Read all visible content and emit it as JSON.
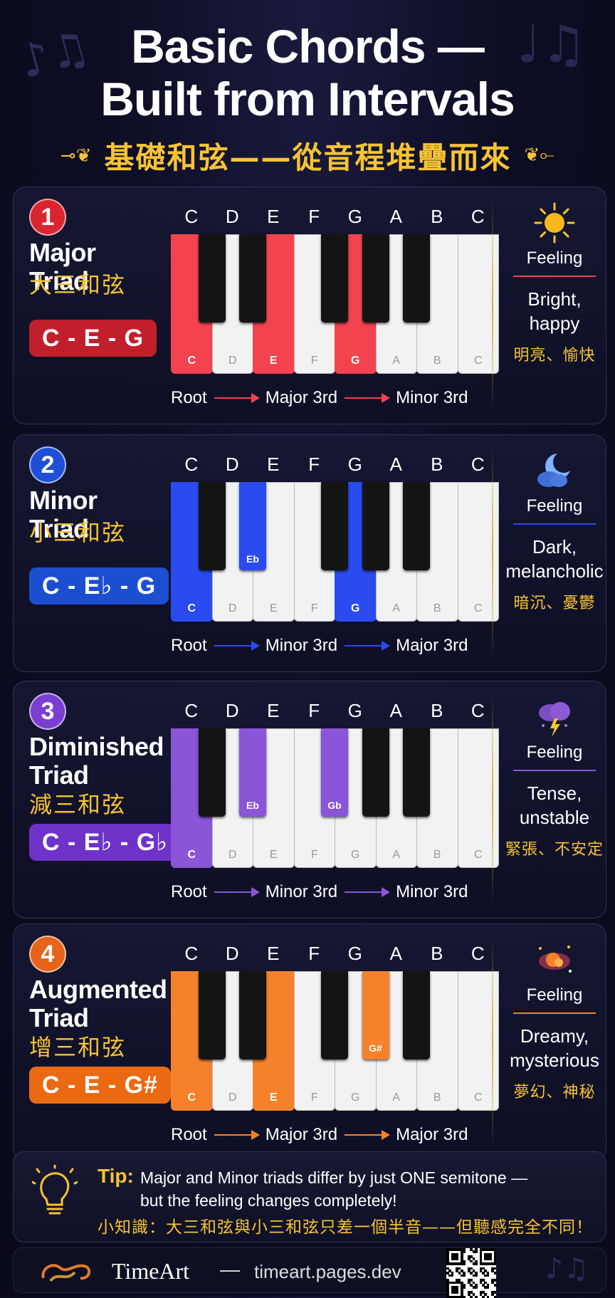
{
  "title_line1": "Basic Chords —",
  "title_line2": "Built from Intervals",
  "subtitle": "基礎和弦——從音程堆疊而來",
  "note_names": [
    "C",
    "D",
    "E",
    "F",
    "G",
    "A",
    "B",
    "C"
  ],
  "feeling_label": "Feeling",
  "chords": [
    {
      "number": "1",
      "name": "Major Triad",
      "zh": "大三和弦",
      "formula": "C - E - G",
      "color": "#f2434f",
      "badge_color": "#d9252f",
      "formula_bg": "#c21f2c",
      "intervals": [
        "Root",
        "Major 3rd",
        "Minor 3rd"
      ],
      "feeling_en": "Bright, happy",
      "feeling_zh": "明亮、愉快",
      "icon": "sun-icon",
      "highlight_white": [
        0,
        2,
        4
      ],
      "highlight_black": []
    },
    {
      "number": "2",
      "name": "Minor Triad",
      "zh": "小三和弦",
      "formula": "C - E♭ - G",
      "color": "#2a4bf0",
      "badge_color": "#1f4fd6",
      "formula_bg": "#1b4fcf",
      "intervals": [
        "Root",
        "Minor 3rd",
        "Major 3rd"
      ],
      "feeling_en": "Dark, melancholic",
      "feeling_zh": "暗沉、憂鬱",
      "icon": "moon-cloud-icon",
      "highlight_white": [
        0,
        4
      ],
      "highlight_black": [
        1
      ],
      "black_labels": {
        "1": "Eb"
      }
    },
    {
      "number": "3",
      "name": "Diminished Triad",
      "zh": "減三和弦",
      "formula": "C - E♭ - G♭",
      "color": "#8a55d6",
      "badge_color": "#7a3fd0",
      "formula_bg": "#6f32c8",
      "intervals": [
        "Root",
        "Minor 3rd",
        "Minor 3rd"
      ],
      "feeling_en": "Tense, unstable",
      "feeling_zh": "緊張、不安定",
      "icon": "storm-cloud-icon",
      "highlight_white": [
        0
      ],
      "highlight_black": [
        1,
        2
      ],
      "black_labels": {
        "1": "Eb",
        "2": "Gb"
      }
    },
    {
      "number": "4",
      "name": "Augmented Triad",
      "zh": "增三和弦",
      "formula": "C - E - G#",
      "color": "#f5822b",
      "badge_color": "#e5641a",
      "formula_bg": "#ea6a14",
      "intervals": [
        "Root",
        "Major 3rd",
        "Major 3rd"
      ],
      "feeling_en": "Dreamy, mysterious",
      "feeling_zh": "夢幻、神秘",
      "icon": "nebula-icon",
      "highlight_white": [
        0,
        2
      ],
      "highlight_black": [
        3
      ],
      "black_labels": {
        "3": "G#"
      }
    }
  ],
  "tip": {
    "label": "Tip:",
    "line1": "Major and Minor triads differ by just ONE semitone —",
    "line2": "but the feeling changes completely!",
    "zh": "小知識：大三和弦與小三和弦只差一個半音——但聽感完全不同！"
  },
  "footer": {
    "brand": "TimeArt",
    "separator": "—",
    "site": "timeart.pages.dev"
  }
}
